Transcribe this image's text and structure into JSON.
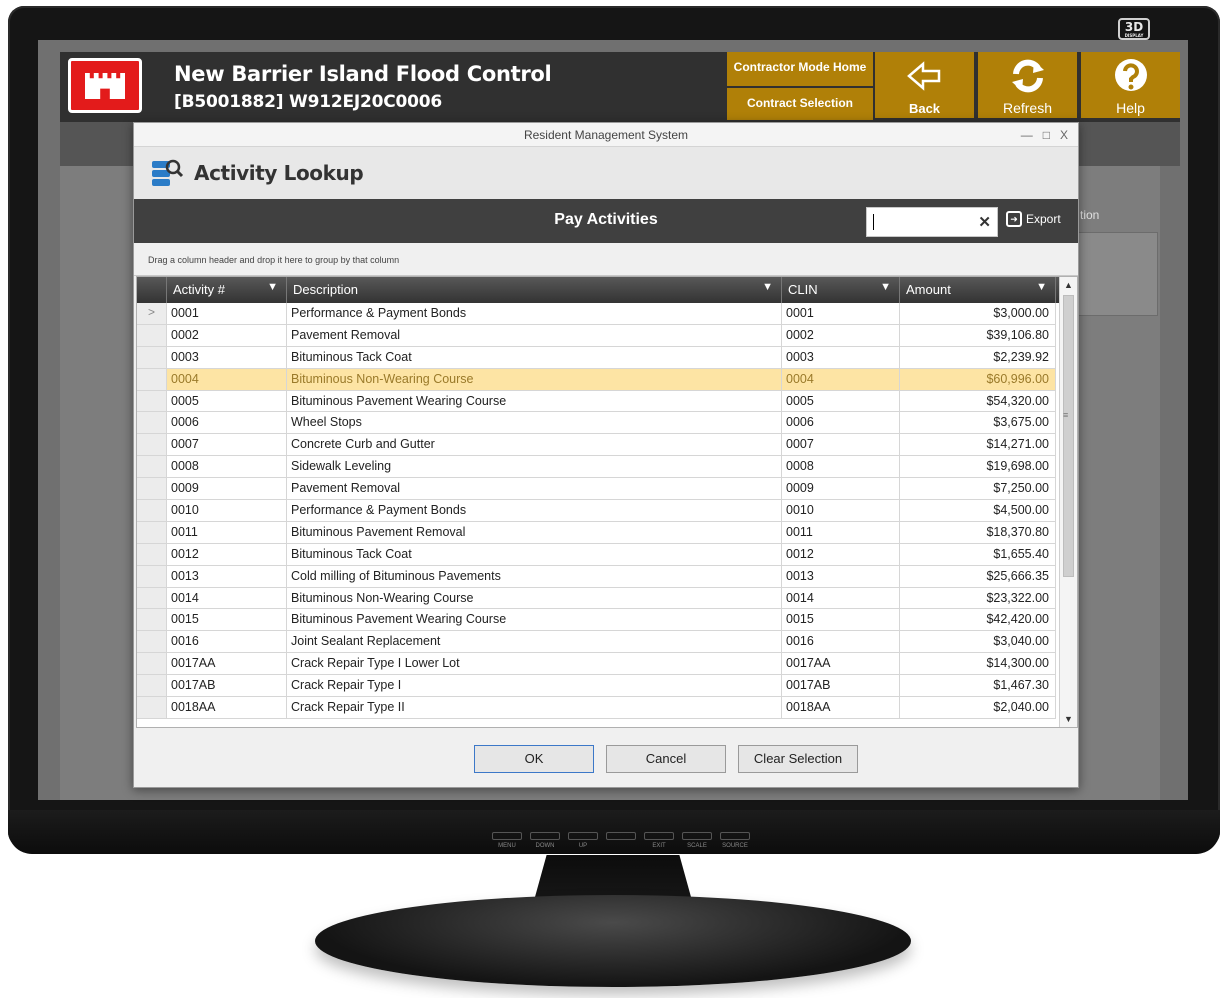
{
  "project": {
    "title": "New Barrier Island Flood Control",
    "subtitle": "[B5001882] W912EJ20C0006"
  },
  "header_buttons": {
    "contractor_home": "Contractor Mode Home",
    "contract_selection": "Contract Selection",
    "back": "Back",
    "refresh": "Refresh",
    "help": "Help"
  },
  "background": {
    "partial_label": "tion"
  },
  "window": {
    "title": "Resident Management System",
    "minimize": "—",
    "maximize": "□",
    "close": "X"
  },
  "lookup": {
    "title": "Activity Lookup",
    "bar_title": "Pay Activities",
    "search_value": "",
    "clear_label": "✕",
    "export_label": "Export",
    "group_hint": "Drag a column header and drop it here to group by that column"
  },
  "columns": [
    "Activity #",
    "Description",
    "CLIN",
    "Amount"
  ],
  "rows": [
    {
      "activity": "0001",
      "description": "Performance & Payment Bonds",
      "clin": "0001",
      "amount": "$3,000.00",
      "indicator": ">"
    },
    {
      "activity": "0002",
      "description": "Pavement Removal",
      "clin": "0002",
      "amount": "$39,106.80",
      "indicator": ""
    },
    {
      "activity": "0003",
      "description": "Bituminous Tack Coat",
      "clin": "0003",
      "amount": "$2,239.92",
      "indicator": ""
    },
    {
      "activity": "0004",
      "description": "Bituminous Non-Wearing Course",
      "clin": "0004",
      "amount": "$60,996.00",
      "indicator": ""
    },
    {
      "activity": "0005",
      "description": "Bituminous Pavement Wearing Course",
      "clin": "0005",
      "amount": "$54,320.00",
      "indicator": ""
    },
    {
      "activity": "0006",
      "description": "Wheel Stops",
      "clin": "0006",
      "amount": "$3,675.00",
      "indicator": ""
    },
    {
      "activity": "0007",
      "description": "Concrete Curb and Gutter",
      "clin": "0007",
      "amount": "$14,271.00",
      "indicator": ""
    },
    {
      "activity": "0008",
      "description": "Sidewalk Leveling",
      "clin": "0008",
      "amount": "$19,698.00",
      "indicator": ""
    },
    {
      "activity": "0009",
      "description": "Pavement Removal",
      "clin": "0009",
      "amount": "$7,250.00",
      "indicator": ""
    },
    {
      "activity": "0010",
      "description": "Performance & Payment Bonds",
      "clin": "0010",
      "amount": "$4,500.00",
      "indicator": ""
    },
    {
      "activity": "0011",
      "description": "Bituminous Pavement Removal",
      "clin": "0011",
      "amount": "$18,370.80",
      "indicator": ""
    },
    {
      "activity": "0012",
      "description": "Bituminous Tack Coat",
      "clin": "0012",
      "amount": "$1,655.40",
      "indicator": ""
    },
    {
      "activity": "0013",
      "description": "Cold milling of Bituminous Pavements",
      "clin": "0013",
      "amount": "$25,666.35",
      "indicator": ""
    },
    {
      "activity": "0014",
      "description": "Bituminous Non-Wearing Course",
      "clin": "0014",
      "amount": "$23,322.00",
      "indicator": ""
    },
    {
      "activity": "0015",
      "description": "Bituminous Pavement Wearing Course",
      "clin": "0015",
      "amount": "$42,420.00",
      "indicator": ""
    },
    {
      "activity": "0016",
      "description": "Joint Sealant Replacement",
      "clin": "0016",
      "amount": "$3,040.00",
      "indicator": ""
    },
    {
      "activity": "0017AA",
      "description": "Crack Repair Type I Lower Lot",
      "clin": "0017AA",
      "amount": "$14,300.00",
      "indicator": ""
    },
    {
      "activity": "0017AB",
      "description": "Crack Repair Type I",
      "clin": "0017AB",
      "amount": "$1,467.30",
      "indicator": ""
    },
    {
      "activity": "0018AA",
      "description": "Crack Repair Type II",
      "clin": "0018AA",
      "amount": "$2,040.00",
      "indicator": ""
    }
  ],
  "selected_row_index": 3,
  "dialog_buttons": {
    "ok": "OK",
    "cancel": "Cancel",
    "clear": "Clear Selection"
  },
  "monitor": {
    "badge": "3D",
    "badge_small": "DISPLAY",
    "controls": [
      "MENU",
      "DOWN",
      "UP",
      "",
      "EXIT",
      "SCALE",
      "SOURCE"
    ]
  },
  "colors": {
    "brand_red": "#e31b1b",
    "gold": "#b08008",
    "selected_row": "#fde4a4",
    "header_dark": "#303030"
  }
}
